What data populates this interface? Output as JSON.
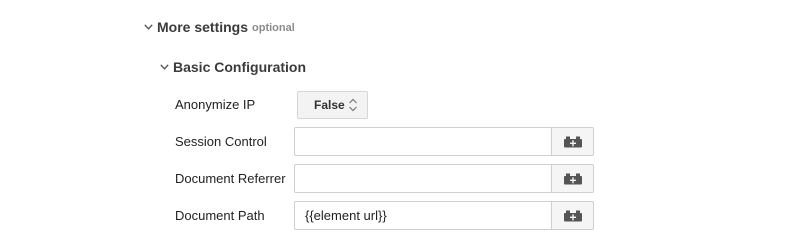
{
  "more_settings": {
    "title": "More settings",
    "optional_label": "optional",
    "expand_icon": "chevron-down-icon"
  },
  "basic_configuration": {
    "title": "Basic Configuration",
    "expand_icon": "chevron-down-icon"
  },
  "fields": {
    "anonymize_ip": {
      "label": "Anonymize IP",
      "value": "False",
      "icon": "up-down-arrows-icon"
    },
    "session_control": {
      "label": "Session Control",
      "value": "",
      "button_icon": "variable-brick-icon"
    },
    "document_referrer": {
      "label": "Document Referrer",
      "value": "",
      "button_icon": "variable-brick-icon"
    },
    "document_path": {
      "label": "Document Path",
      "value": "{{element url}}",
      "button_icon": "variable-brick-icon"
    }
  },
  "colors": {
    "text": "#222222",
    "header_text": "#3b3b3b",
    "muted": "#8a8a8a",
    "border": "#cfcfcf",
    "button_bg": "#f5f5f5",
    "icon": "#555555"
  }
}
